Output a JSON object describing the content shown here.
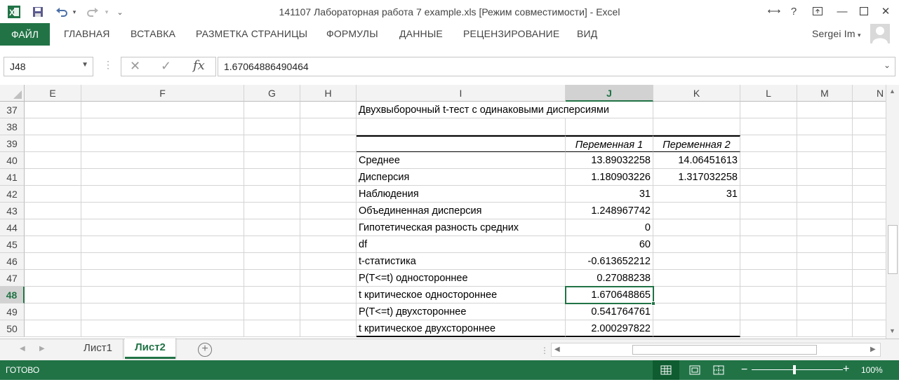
{
  "window": {
    "title": "141107 Лабораторная работа 7 example.xls  [Режим совместимости] - Excel",
    "user": "Sergei Im"
  },
  "ribbon": {
    "file_tab": "ФАЙЛ",
    "tabs": [
      "ГЛАВНАЯ",
      "ВСТАВКА",
      "РАЗМЕТКА СТРАНИЦЫ",
      "ФОРМУЛЫ",
      "ДАННЫЕ",
      "РЕЦЕНЗИРОВАНИЕ",
      "ВИД"
    ]
  },
  "formula_bar": {
    "name_box": "J48",
    "fx_label": "fx",
    "formula": "1.67064886490464"
  },
  "columns": [
    "E",
    "F",
    "G",
    "H",
    "I",
    "J",
    "K",
    "L",
    "M",
    "N"
  ],
  "selected_column": "J",
  "rows": [
    "37",
    "38",
    "39",
    "40",
    "41",
    "42",
    "43",
    "44",
    "45",
    "46",
    "47",
    "48",
    "49",
    "50"
  ],
  "selected_row": "48",
  "table": {
    "title": "Двухвыборочный t-тест с одинаковыми дисперсиями",
    "header": [
      "",
      "Переменная 1",
      "Переменная 2"
    ],
    "rows": [
      [
        "Среднее",
        "13.89032258",
        "14.06451613"
      ],
      [
        "Дисперсия",
        "1.180903226",
        "1.317032258"
      ],
      [
        "Наблюдения",
        "31",
        "31"
      ],
      [
        "Объединенная дисперсия",
        "1.248967742",
        ""
      ],
      [
        "Гипотетическая разность средних",
        "0",
        ""
      ],
      [
        "df",
        "60",
        ""
      ],
      [
        "t-статистика",
        "-0.613652212",
        ""
      ],
      [
        "P(T<=t) одностороннее",
        "0.27088238",
        ""
      ],
      [
        "t критическое одностороннее",
        "1.670648865",
        ""
      ],
      [
        "P(T<=t) двухстороннее",
        "0.541764761",
        ""
      ],
      [
        "t критическое двухстороннее",
        "2.000297822",
        ""
      ]
    ]
  },
  "sheets": {
    "tabs": [
      "Лист1",
      "Лист2"
    ],
    "active": "Лист2"
  },
  "status": {
    "mode": "ГОТОВО",
    "zoom": "100%"
  },
  "colors": {
    "accent": "#217346"
  }
}
